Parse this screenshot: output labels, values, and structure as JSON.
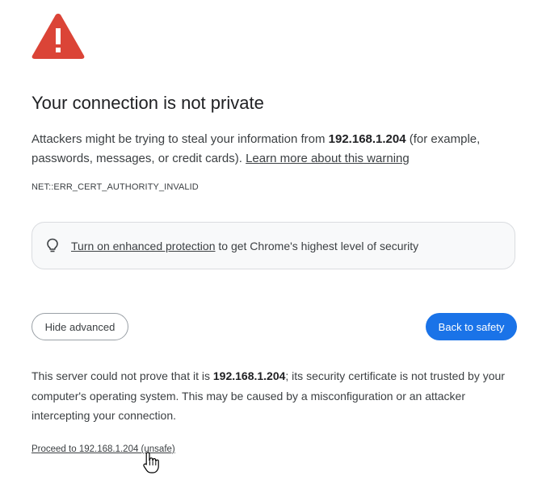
{
  "icons": {
    "warning": "warning-triangle-icon",
    "bulb": "lightbulb-icon",
    "cursor": "hand-pointer-icon"
  },
  "colors": {
    "warning_red": "#db4437",
    "primary_button": "#1a73e8",
    "text": "#3c4043"
  },
  "title": "Your connection is not private",
  "explanation": {
    "part1": "Attackers might be trying to steal your information from ",
    "host": "192.168.1.204",
    "part2": " (for example, passwords, messages, or credit cards). ",
    "learn_more": "Learn more about this warning"
  },
  "error_code": "NET::ERR_CERT_AUTHORITY_INVALID",
  "enhanced": {
    "link": "Turn on enhanced protection",
    "text": " to get Chrome's highest level of security"
  },
  "buttons": {
    "hide_advanced": "Hide advanced",
    "back_to_safety": "Back to safety"
  },
  "details": {
    "part1": "This server could not prove that it is ",
    "host": "192.168.1.204",
    "part2": "; its security certificate is not trusted by your computer's operating system. This may be caused by a misconfiguration or an attacker intercepting your connection."
  },
  "proceed_link": "Proceed to 192.168.1.204 (unsafe)"
}
